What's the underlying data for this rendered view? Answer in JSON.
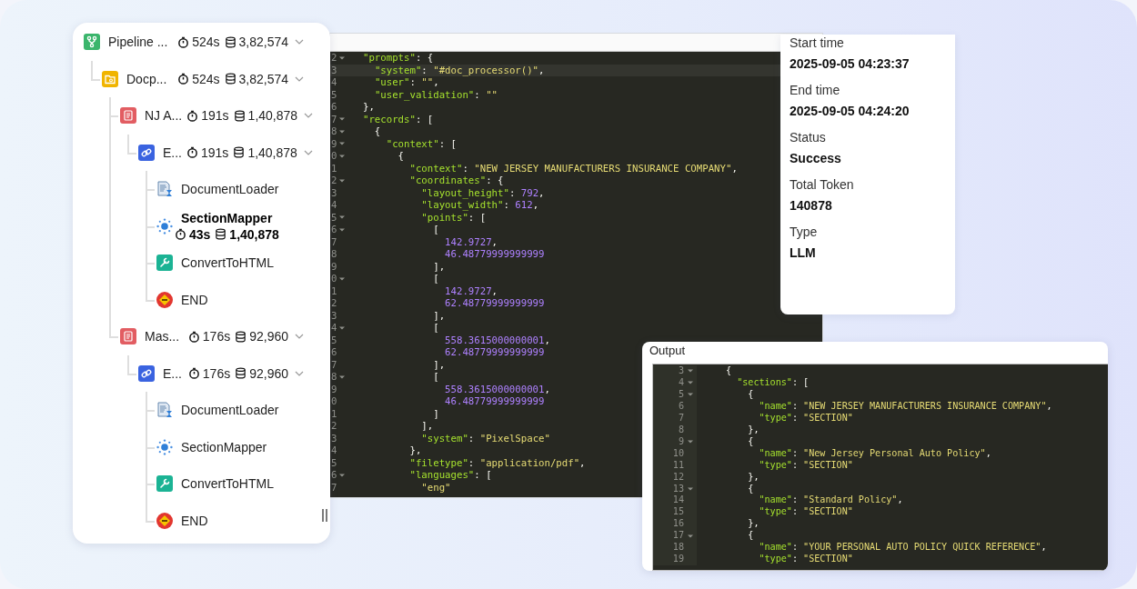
{
  "tree": [
    {
      "name": "Pipeline ...",
      "kind": "pipeline",
      "time": "524s",
      "tokens": "3,82,574",
      "selected": false,
      "expanded": true,
      "children": [
        {
          "name": "Docp...",
          "kind": "folder",
          "time": "524s",
          "tokens": "3,82,574",
          "selected": false,
          "expanded": true,
          "children": [
            {
              "name": "NJ A...",
              "kind": "document",
              "time": "191s",
              "tokens": "1,40,878",
              "selected": false,
              "expanded": true,
              "children": [
                {
                  "name": "E...",
                  "kind": "link",
                  "time": "191s",
                  "tokens": "1,40,878",
                  "selected": false,
                  "expanded": true,
                  "children": [
                    {
                      "name": "DocumentLoader",
                      "kind": "loader",
                      "selected": false
                    },
                    {
                      "name": "SectionMapper",
                      "kind": "mapper",
                      "time": "43s",
                      "tokens": "1,40,878",
                      "selected": true
                    },
                    {
                      "name": "ConvertToHTML",
                      "kind": "wrench",
                      "selected": false
                    },
                    {
                      "name": "END",
                      "kind": "end",
                      "selected": false
                    }
                  ]
                }
              ]
            },
            {
              "name": "Mas...",
              "kind": "document",
              "time": "176s",
              "tokens": "92,960",
              "selected": false,
              "expanded": true,
              "children": [
                {
                  "name": "E...",
                  "kind": "link",
                  "time": "176s",
                  "tokens": "92,960",
                  "selected": false,
                  "expanded": true,
                  "children": [
                    {
                      "name": "DocumentLoader",
                      "kind": "loader",
                      "selected": false
                    },
                    {
                      "name": "SectionMapper",
                      "kind": "mapper",
                      "selected": false
                    },
                    {
                      "name": "ConvertToHTML",
                      "kind": "wrench",
                      "selected": false
                    },
                    {
                      "name": "END",
                      "kind": "end",
                      "selected": false
                    }
                  ]
                }
              ]
            }
          ]
        }
      ]
    }
  ],
  "editor": {
    "lines": [
      {
        "num": "2",
        "text": "\"prompts\": {",
        "fold": true,
        "active": false
      },
      {
        "num": "3",
        "text": "  \"system\": \"#doc_processor()\",",
        "fold": false,
        "active": true
      },
      {
        "num": "4",
        "text": "  \"user\": \"\",",
        "fold": false,
        "active": false
      },
      {
        "num": "5",
        "text": "  \"user_validation\": \"\"",
        "fold": false,
        "active": false
      },
      {
        "num": "6",
        "text": "},",
        "fold": false,
        "active": false
      },
      {
        "num": "7",
        "text": "\"records\": [",
        "fold": true,
        "active": false
      },
      {
        "num": "8",
        "text": "  {",
        "fold": true,
        "active": false
      },
      {
        "num": "9",
        "text": "    \"context\": [",
        "fold": true,
        "active": false
      },
      {
        "num": "0",
        "text": "      {",
        "fold": true,
        "active": false
      },
      {
        "num": "1",
        "text": "        \"context\": \"NEW JERSEY MANUFACTURERS INSURANCE COMPANY\",",
        "fold": false,
        "active": false
      },
      {
        "num": "2",
        "text": "        \"coordinates\": {",
        "fold": true,
        "active": false
      },
      {
        "num": "3",
        "text": "          \"layout_height\": 792,",
        "fold": false,
        "active": false
      },
      {
        "num": "4",
        "text": "          \"layout_width\": 612,",
        "fold": false,
        "active": false
      },
      {
        "num": "5",
        "text": "          \"points\": [",
        "fold": true,
        "active": false
      },
      {
        "num": "6",
        "text": "            [",
        "fold": true,
        "active": false
      },
      {
        "num": "7",
        "text": "              142.9727,",
        "fold": false,
        "active": false
      },
      {
        "num": "8",
        "text": "              46.48779999999999",
        "fold": false,
        "active": false
      },
      {
        "num": "9",
        "text": "            ],",
        "fold": false,
        "active": false
      },
      {
        "num": "0",
        "text": "            [",
        "fold": true,
        "active": false
      },
      {
        "num": "1",
        "text": "              142.9727,",
        "fold": false,
        "active": false
      },
      {
        "num": "2",
        "text": "              62.48779999999999",
        "fold": false,
        "active": false
      },
      {
        "num": "3",
        "text": "            ],",
        "fold": false,
        "active": false
      },
      {
        "num": "4",
        "text": "            [",
        "fold": true,
        "active": false
      },
      {
        "num": "5",
        "text": "              558.3615000000001,",
        "fold": false,
        "active": false
      },
      {
        "num": "6",
        "text": "              62.48779999999999",
        "fold": false,
        "active": false
      },
      {
        "num": "7",
        "text": "            ],",
        "fold": false,
        "active": false
      },
      {
        "num": "8",
        "text": "            [",
        "fold": true,
        "active": false
      },
      {
        "num": "9",
        "text": "              558.3615000000001,",
        "fold": false,
        "active": false
      },
      {
        "num": "0",
        "text": "              46.48779999999999",
        "fold": false,
        "active": false
      },
      {
        "num": "1",
        "text": "            ]",
        "fold": false,
        "active": false
      },
      {
        "num": "2",
        "text": "          ],",
        "fold": false,
        "active": false
      },
      {
        "num": "3",
        "text": "          \"system\": \"PixelSpace\"",
        "fold": false,
        "active": false
      },
      {
        "num": "4",
        "text": "        },",
        "fold": false,
        "active": false
      },
      {
        "num": "5",
        "text": "        \"filetype\": \"application/pdf\",",
        "fold": false,
        "active": false
      },
      {
        "num": "6",
        "text": "        \"languages\": [",
        "fold": true,
        "active": false
      },
      {
        "num": "7",
        "text": "          \"eng\"",
        "fold": false,
        "active": false
      }
    ]
  },
  "details": [
    {
      "label": "Start time",
      "value": "2025-09-05 04:23:37"
    },
    {
      "label": "End time",
      "value": "2025-09-05 04:24:20"
    },
    {
      "label": "Status",
      "value": "Success"
    },
    {
      "label": "Total Token",
      "value": "140878"
    },
    {
      "label": "Type",
      "value": "LLM"
    }
  ],
  "output": {
    "title": "Output",
    "lines": [
      {
        "num": "3",
        "text": "{",
        "fold": true
      },
      {
        "num": "4",
        "text": "  \"sections\": [",
        "fold": true
      },
      {
        "num": "5",
        "text": "    {",
        "fold": true
      },
      {
        "num": "6",
        "text": "      \"name\": \"NEW JERSEY MANUFACTURERS INSURANCE COMPANY\",",
        "fold": false
      },
      {
        "num": "7",
        "text": "      \"type\": \"SECTION\"",
        "fold": false
      },
      {
        "num": "8",
        "text": "    },",
        "fold": false
      },
      {
        "num": "9",
        "text": "    {",
        "fold": true
      },
      {
        "num": "10",
        "text": "      \"name\": \"New Jersey Personal Auto Policy\",",
        "fold": false
      },
      {
        "num": "11",
        "text": "      \"type\": \"SECTION\"",
        "fold": false
      },
      {
        "num": "12",
        "text": "    },",
        "fold": false
      },
      {
        "num": "13",
        "text": "    {",
        "fold": true
      },
      {
        "num": "14",
        "text": "      \"name\": \"Standard Policy\",",
        "fold": false
      },
      {
        "num": "15",
        "text": "      \"type\": \"SECTION\"",
        "fold": false
      },
      {
        "num": "16",
        "text": "    },",
        "fold": false
      },
      {
        "num": "17",
        "text": "    {",
        "fold": true
      },
      {
        "num": "18",
        "text": "      \"name\": \"YOUR PERSONAL AUTO POLICY QUICK REFERENCE\",",
        "fold": false
      },
      {
        "num": "19",
        "text": "      \"type\": \"SECTION\"",
        "fold": false
      }
    ]
  }
}
